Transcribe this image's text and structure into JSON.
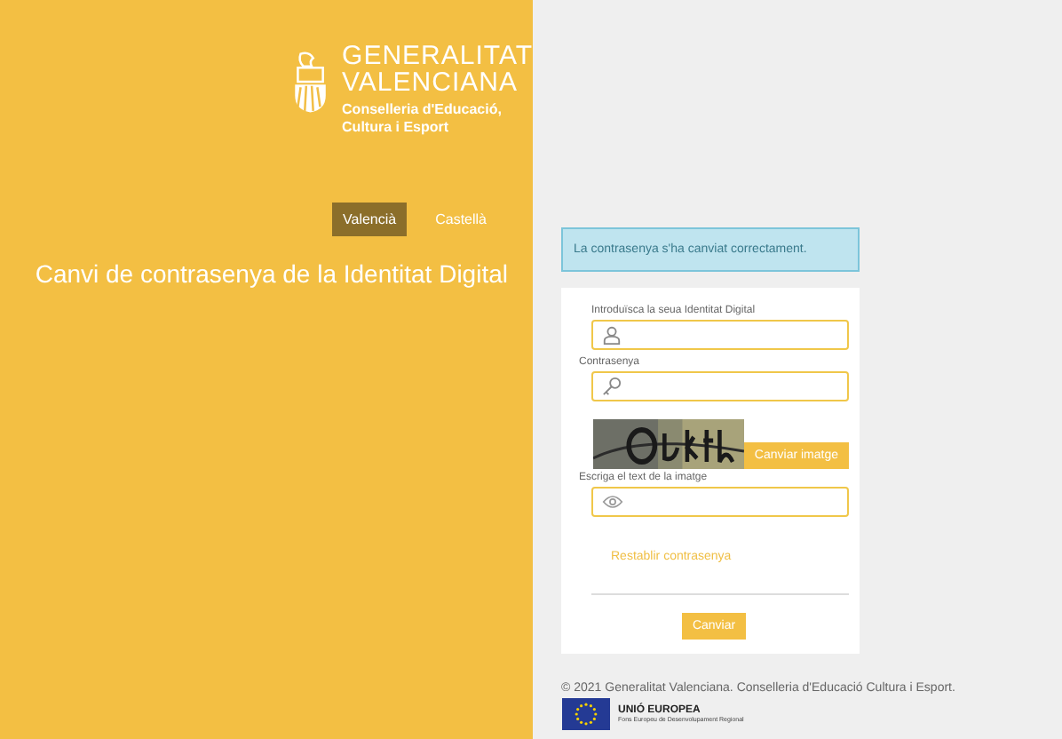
{
  "brand": {
    "name_line_1": "GENERALITAT",
    "name_line_2": "VALENCIANA",
    "department_line_1": "Conselleria d'Educació,",
    "department_line_2": "Cultura i Esport"
  },
  "languages": [
    {
      "label": "Valencià",
      "selected": true
    },
    {
      "label": "Castellà",
      "selected": false
    }
  ],
  "page_title": "Canvi de contrasenya de la Identitat Digital",
  "alert": "La contrasenya s'ha canviat correctament.",
  "form": {
    "fields": [
      {
        "label": "Introduïsca la seua Identitat Digital",
        "kind": "user"
      },
      {
        "label": "Contrasenya",
        "kind": "key"
      }
    ],
    "captcha": {
      "kind": "picture",
      "refresh_button": "Canviar imatge"
    },
    "captcha_field": {
      "label": "Escriga el text de la imatge",
      "kind": "eye"
    },
    "reset_link": "Restablir contrasenya",
    "submit_button": "Canviar"
  },
  "footer": {
    "copyright": "© 2021 Generalitat Valenciana. Conselleria d'Educació Cultura i Esport.",
    "eu_title": "UNIÓ EUROPEA",
    "eu_subtitle": "Fons Europeu de Desenvolupament Regional"
  }
}
